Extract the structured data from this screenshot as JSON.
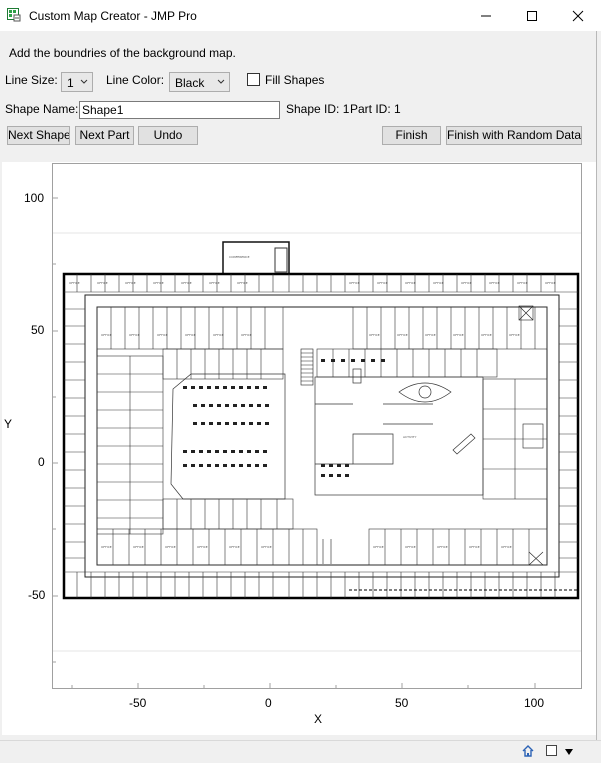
{
  "window": {
    "title": "Custom Map Creator - JMP Pro"
  },
  "instructions": "Add the boundries of the background map.",
  "controls": {
    "line_size_label": "Line Size:",
    "line_size_value": "1",
    "line_color_label": "Line Color:",
    "line_color_value": "Black",
    "fill_shapes_label": "Fill Shapes",
    "fill_shapes_checked": false,
    "shape_name_label": "Shape Name:",
    "shape_name_value": "Shape1",
    "shape_id_text": "Shape ID: 1",
    "part_id_text": "Part ID: 1"
  },
  "buttons": {
    "next_shape": "Next Shape",
    "next_part": "Next Part",
    "undo": "Undo",
    "finish": "Finish",
    "finish_random": "Finish with Random Data"
  },
  "graph": {
    "x_title": "X",
    "y_title": "Y",
    "x_ticks": [
      "-50",
      "0",
      "50",
      "100"
    ],
    "y_ticks": [
      "100",
      "50",
      "0",
      "-50"
    ],
    "background_image": "floor-plan"
  }
}
